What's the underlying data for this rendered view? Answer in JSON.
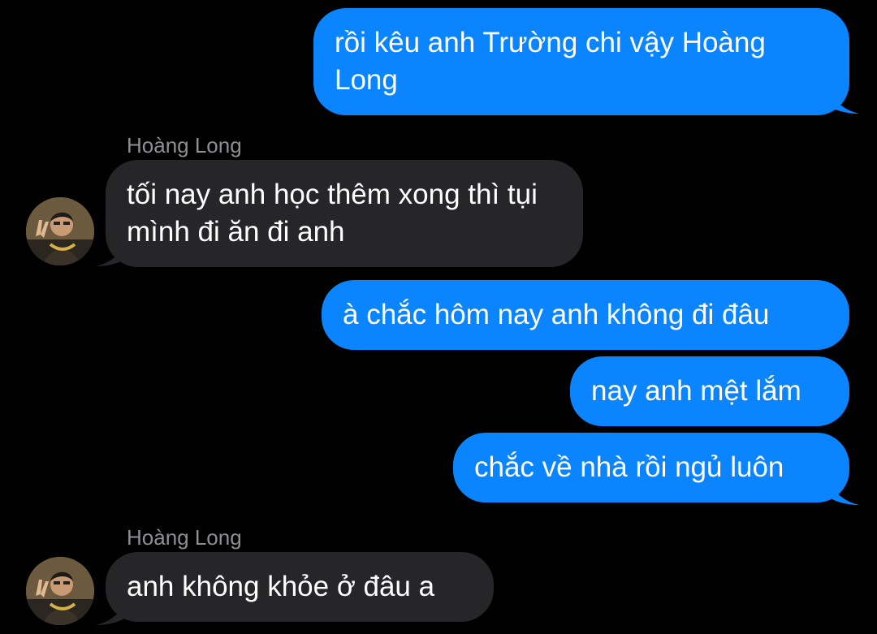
{
  "conversation": {
    "contact_name": "Hoàng Long",
    "messages": [
      {
        "direction": "outgoing",
        "text": "rồi kêu anh Trường chi vậy Hoàng Long"
      },
      {
        "direction": "incoming",
        "sender": "Hoàng Long",
        "text": "tối nay anh học thêm xong thì tụi mình đi ăn đi anh"
      },
      {
        "direction": "outgoing",
        "text": "à chắc hôm nay anh không đi đâu"
      },
      {
        "direction": "outgoing",
        "text": "nay anh mệt lắm"
      },
      {
        "direction": "outgoing",
        "text": "chắc về nhà rồi ngủ luôn"
      },
      {
        "direction": "incoming",
        "sender": "Hoàng Long",
        "text": "anh không khỏe ở đâu a"
      }
    ]
  },
  "colors": {
    "background": "#000000",
    "outgoing_bubble": "#0a84ff",
    "incoming_bubble": "#262628",
    "sender_label": "#8e8e93",
    "text": "#ffffff"
  },
  "icons": {
    "avatar": "contact-avatar-photo"
  }
}
